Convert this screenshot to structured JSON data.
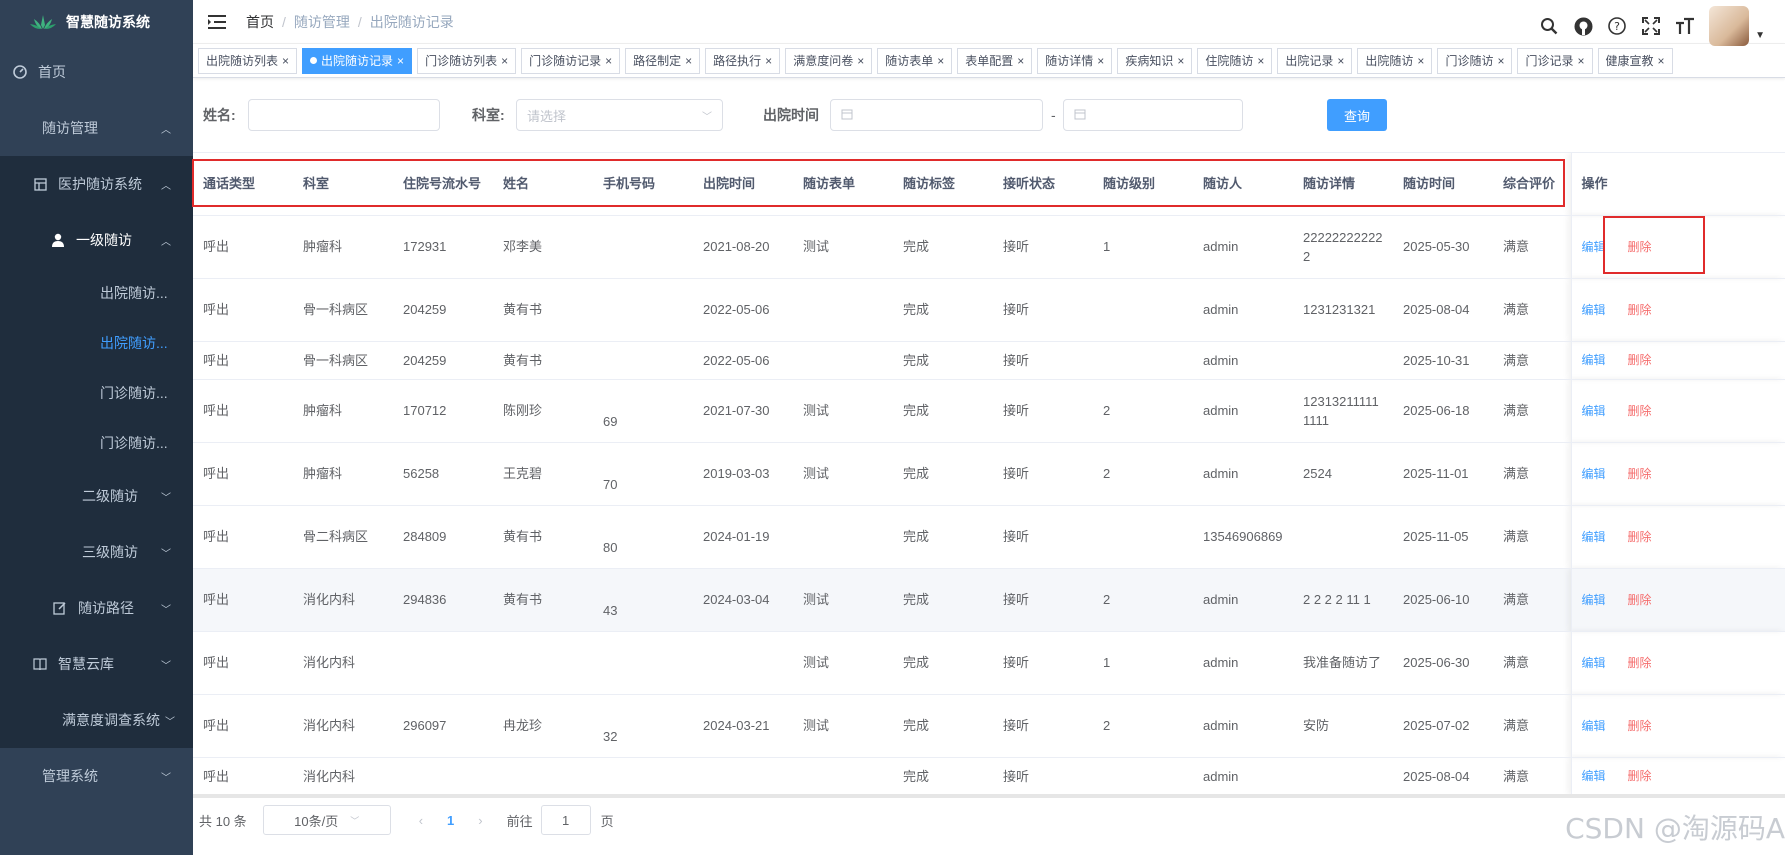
{
  "app": {
    "title": "智慧随访系统"
  },
  "sidebar": {
    "home": "首页",
    "followup_mgmt": "随访管理",
    "nursing_system": "医护随访系统",
    "level1": "一级随访",
    "level1_items": [
      "出院随访...",
      "出院随访...",
      "门诊随访...",
      "门诊随访..."
    ],
    "level2": "二级随访",
    "level3": "三级随访",
    "path": "随访路径",
    "cloud": "智慧云库",
    "survey": "满意度调查系统",
    "admin": "管理系统"
  },
  "breadcrumb": {
    "home": "首页",
    "mid": "随访管理",
    "current": "出院随访记录"
  },
  "tabs": [
    "出院随访列表",
    "出院随访记录",
    "门诊随访列表",
    "门诊随访记录",
    "路径制定",
    "路径执行",
    "满意度问卷",
    "随访表单",
    "表单配置",
    "随访详情",
    "疾病知识",
    "住院随访",
    "出院记录",
    "出院随访",
    "门诊随访",
    "门诊记录",
    "健康宣教"
  ],
  "active_tab_index": 1,
  "filter": {
    "name_label": "姓名:",
    "dept_label": "科室:",
    "dept_placeholder": "请选择",
    "discharge_label": "出院时间",
    "range_sep": "-",
    "query_btn": "查询"
  },
  "table": {
    "headers": [
      "通话类型",
      "科室",
      "住院号流水号",
      "姓名",
      "手机号码",
      "出院时间",
      "随访表单",
      "随访标签",
      "接听状态",
      "随访级别",
      "随访人",
      "随访详情",
      "随访时间",
      "综合评价",
      "操作"
    ],
    "edit": "编辑",
    "delete": "删除",
    "rows": [
      [
        "呼出",
        "肿瘤科",
        "172931",
        "邓李美",
        "",
        "2021-08-20",
        "测试",
        "完成",
        "接听",
        "1",
        "admin",
        "222222222222",
        "2025-05-30",
        "满意"
      ],
      [
        "呼出",
        "骨一科病区",
        "204259",
        "黄有书",
        "",
        "2022-05-06",
        "",
        "完成",
        "接听",
        "",
        "admin",
        "1231231321",
        "2025-08-04",
        "满意"
      ],
      [
        "呼出",
        "骨一科病区",
        "204259",
        "黄有书",
        "",
        "2022-05-06",
        "",
        "完成",
        "接听",
        "",
        "admin",
        "",
        "2025-10-31",
        "满意"
      ],
      [
        "呼出",
        "肿瘤科",
        "170712",
        "陈刚珍",
        "69",
        "2021-07-30",
        "测试",
        "完成",
        "接听",
        "2",
        "admin",
        "123132111111111",
        "2025-06-18",
        "满意"
      ],
      [
        "呼出",
        "肿瘤科",
        "56258",
        "王克碧",
        "70",
        "2019-03-03",
        "测试",
        "完成",
        "接听",
        "2",
        "admin",
        "2524",
        "2025-11-01",
        "满意"
      ],
      [
        "呼出",
        "骨二科病区",
        "284809",
        "黄有书",
        "80",
        "2024-01-19",
        "",
        "完成",
        "接听",
        "",
        "13546906869",
        "",
        "2025-11-05",
        "满意"
      ],
      [
        "呼出",
        "消化内科",
        "294836",
        "黄有书",
        "43",
        "2024-03-04",
        "测试",
        "完成",
        "接听",
        "2",
        "admin",
        "2 2 2 2 11 1",
        "2025-06-10",
        "满意"
      ],
      [
        "呼出",
        "消化内科",
        "",
        "",
        "",
        "",
        "测试",
        "完成",
        "接听",
        "1",
        "admin",
        "我准备随访了",
        "2025-06-30",
        "满意"
      ],
      [
        "呼出",
        "消化内科",
        "296097",
        "冉龙珍",
        "32",
        "2024-03-21",
        "测试",
        "完成",
        "接听",
        "2",
        "admin",
        "安防",
        "2025-07-02",
        "满意"
      ],
      [
        "呼出",
        "消化内科",
        "",
        "",
        "",
        "",
        "",
        "完成",
        "接听",
        "",
        "admin",
        "",
        "2025-08-04",
        "满意"
      ]
    ]
  },
  "pager": {
    "total": "共 10 条",
    "size": "10条/页",
    "page": "1",
    "goto": "前往",
    "goto_val": "1",
    "page_unit": "页"
  },
  "watermark": "CSDN @淘源码A"
}
